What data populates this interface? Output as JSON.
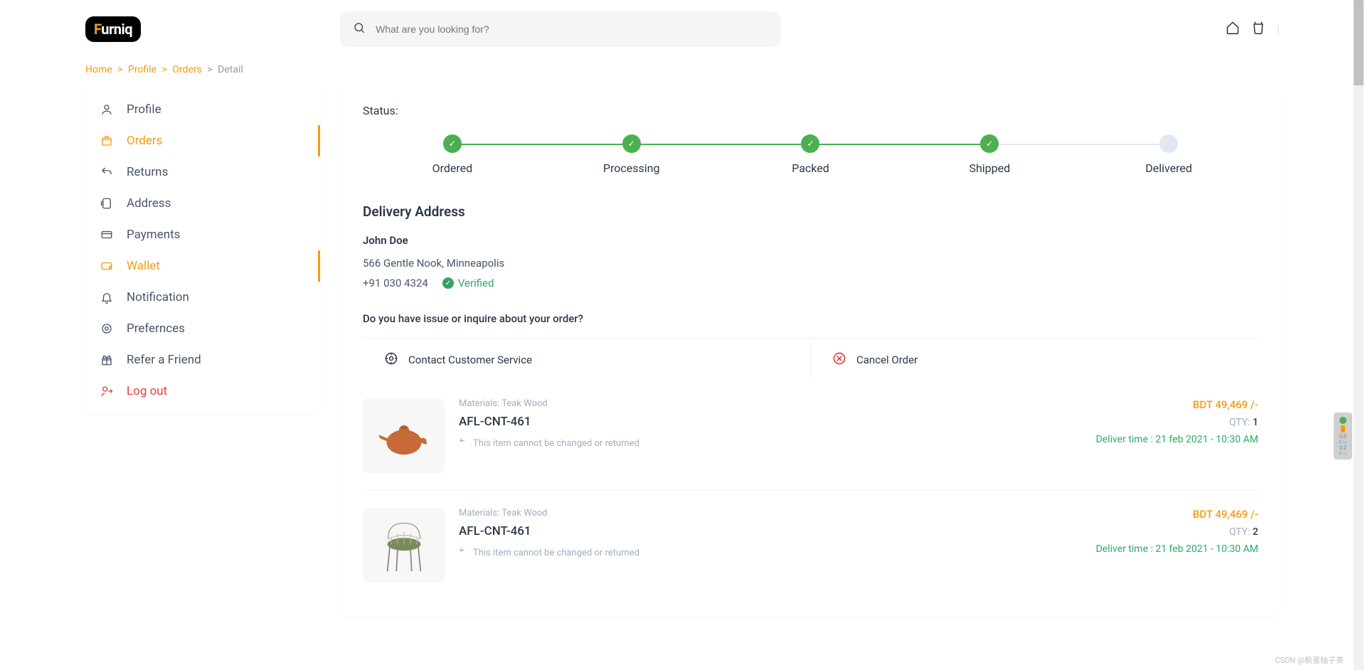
{
  "logo": {
    "prefix": "F",
    "rest": "urniq"
  },
  "search": {
    "placeholder": "What are you looking for?"
  },
  "breadcrumb": {
    "home": "Home",
    "profile": "Profile",
    "orders": "Orders",
    "detail": "Detail"
  },
  "sidebar": {
    "items": [
      {
        "label": "Profile",
        "icon": "user"
      },
      {
        "label": "Orders",
        "icon": "box",
        "active": true
      },
      {
        "label": "Returns",
        "icon": "return"
      },
      {
        "label": "Address",
        "icon": "map"
      },
      {
        "label": "Payments",
        "icon": "card"
      },
      {
        "label": "Wallet",
        "icon": "wallet",
        "hover": true
      },
      {
        "label": "Notification",
        "icon": "bell"
      },
      {
        "label": "Prefernces",
        "icon": "gear"
      },
      {
        "label": "Refer a Friend",
        "icon": "gift"
      },
      {
        "label": "Log out",
        "icon": "logout",
        "logout": true
      }
    ]
  },
  "status": {
    "label": "Status:",
    "steps": [
      {
        "label": "Ordered",
        "done": true
      },
      {
        "label": "Processing",
        "done": true
      },
      {
        "label": "Packed",
        "done": true
      },
      {
        "label": "Shipped",
        "done": true
      },
      {
        "label": "Delivered",
        "done": false
      }
    ]
  },
  "delivery": {
    "title": "Delivery Address",
    "name": "John Doe",
    "street": "566 Gentle Nook, Minneapolis",
    "phone": "+91 030 4324",
    "verified": "Verified"
  },
  "inquiry": {
    "question": "Do you have issue or inquire about your order?",
    "contact": "Contact Customer Service",
    "cancel": "Cancel Order"
  },
  "orders": [
    {
      "materials_label": "Materials:",
      "materials": "Teak Wood",
      "sku": "AFL-CNT-461",
      "note": "This item cannot be changed or returned",
      "price": "BDT 49,469 /-",
      "qty_label": "QTY:",
      "qty": "1",
      "delivery": "Deliver time : 21 feb 2021 - 10:30 AM",
      "kind": "teapot"
    },
    {
      "materials_label": "Materials:",
      "materials": "Teak Wood",
      "sku": "AFL-CNT-461",
      "note": "This item cannot be changed or returned",
      "price": "BDT 49,469 /-",
      "qty_label": "QTY:",
      "qty": "2",
      "delivery": "Deliver time : 21 feb 2021 - 10:30 AM",
      "kind": "chair"
    }
  ],
  "widget": {
    "val1": "0.0",
    "unit": "K/s",
    "val2": "0.2"
  },
  "watermark": "CSDN @枫蜜柚子茶"
}
